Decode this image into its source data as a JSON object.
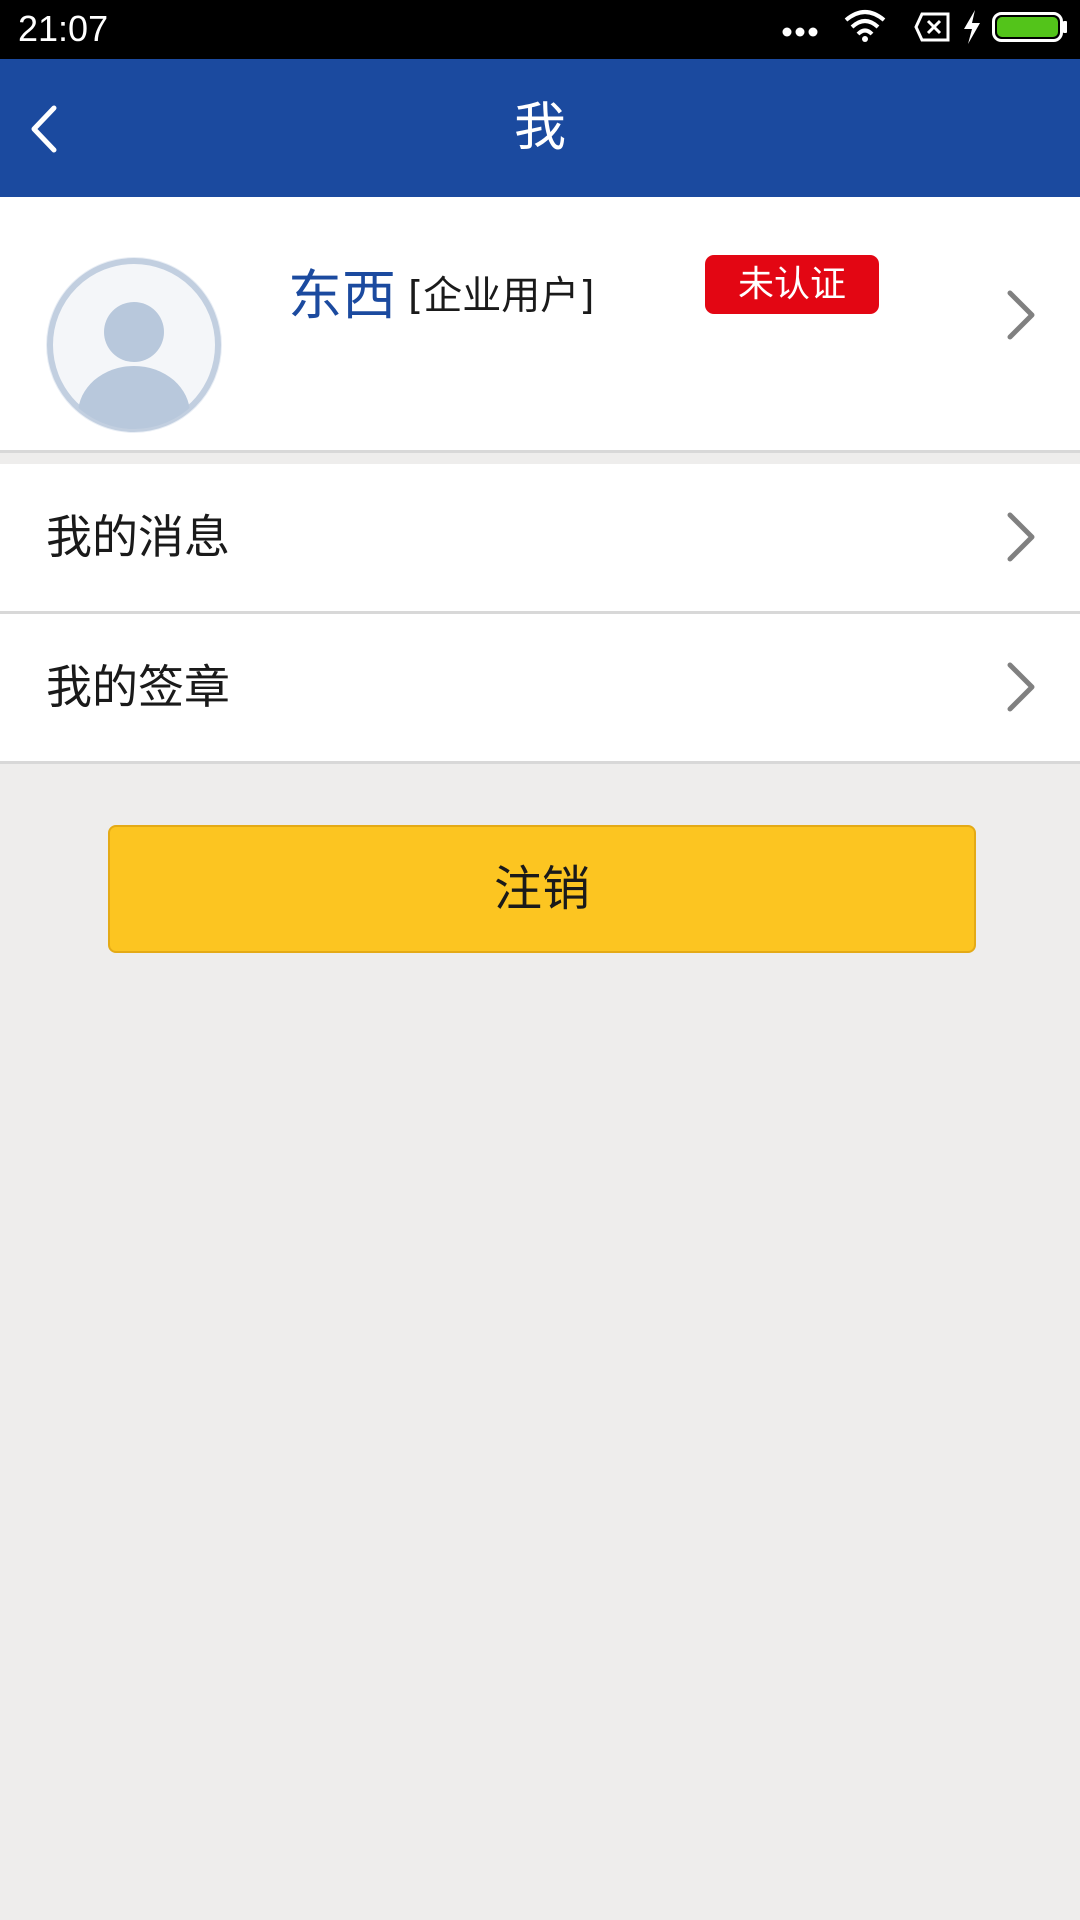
{
  "status_bar": {
    "time": "21:07",
    "icons": [
      "more-dots-icon",
      "wifi-icon",
      "no-sim-icon",
      "charging-icon",
      "battery-icon"
    ],
    "battery_color": "#53c41a"
  },
  "app_bar": {
    "title": "我",
    "back_icon": "chevron-left-icon",
    "background_color": "#1b4a9f"
  },
  "profile": {
    "name": "东西",
    "user_type": "[企业用户]",
    "badge": "未认证",
    "badge_color": "#e30613",
    "avatar_icon": "default-avatar-icon"
  },
  "menu": {
    "items": [
      {
        "label": "我的消息"
      },
      {
        "label": "我的签章"
      }
    ]
  },
  "logout": {
    "label": "注销",
    "color": "#fcc521"
  }
}
